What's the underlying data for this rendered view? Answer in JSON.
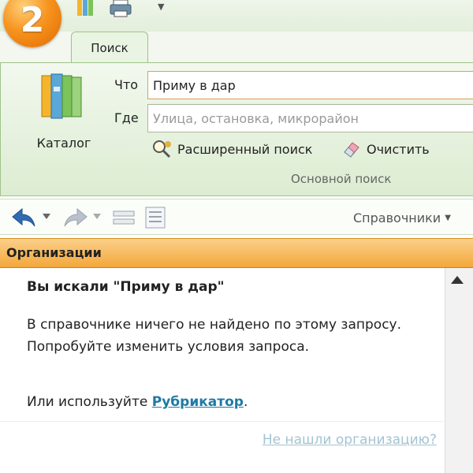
{
  "app": {
    "logo_number": "2"
  },
  "quick_access": {
    "icons": [
      "catalog-small-icon",
      "printer-icon",
      "dropdown-arrow-icon"
    ]
  },
  "tabs": [
    {
      "label": "Поиск",
      "active": true
    }
  ],
  "ribbon": {
    "catalog_label": "Каталог",
    "what_label": "Что",
    "what_value": "Приму в дар",
    "where_label": "Где",
    "where_placeholder": "Улица, остановка, микрорайон",
    "advanced_search_label": "Расширенный поиск",
    "clear_label": "Очистить",
    "group_label": "Основной поиск"
  },
  "toolbar": {
    "directories_label": "Справочники"
  },
  "panel": {
    "header": "Организации"
  },
  "content": {
    "heading": "Вы искали \"Приму в дар\"",
    "message": "В справочнике ничего не найдено по этому запросу. Попробуйте изменить условия запроса.",
    "use_prefix": "Или используйте ",
    "rubricator_link": "Рубрикатор",
    "use_suffix": ".",
    "not_found_link": "Не нашли организацию?"
  },
  "colors": {
    "ribbon_bg": "#e6f1dd",
    "header_orange": "#f3a73a",
    "link_blue": "#1f7aa3",
    "faded_link": "#a3c3d3",
    "logo_orange": "#f7931e"
  }
}
